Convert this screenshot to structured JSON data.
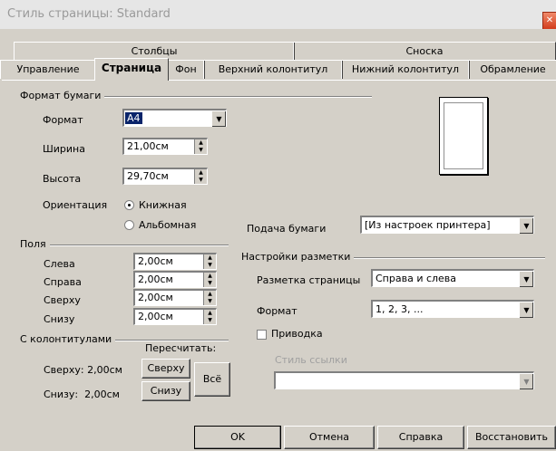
{
  "window": {
    "title": "Стиль страницы: Standard",
    "close": "✕"
  },
  "tabs": {
    "row1": [
      "Столбцы",
      "Сноска"
    ],
    "row2": [
      "Управление",
      "Страница",
      "Фон",
      "Верхний колонтитул",
      "Нижний колонтитул",
      "Обрамление"
    ],
    "active": "Страница"
  },
  "paper_format": {
    "section_title": "Формат бумаги",
    "format_label": "Формат",
    "format_value": "A4",
    "width_label": "Ширина",
    "width_value": "21,00см",
    "height_label": "Высота",
    "height_value": "29,70см",
    "orientation_label": "Ориентация",
    "portrait": "Книжная",
    "landscape": "Альбомная",
    "orientation_selected": "portrait",
    "paper_source_label": "Подача бумаги",
    "paper_source_value": "[Из настроек принтера]"
  },
  "margins": {
    "section_title": "Поля",
    "left_label": "Слева",
    "left_value": "2,00см",
    "right_label": "Справа",
    "right_value": "2,00см",
    "top_label": "Сверху",
    "top_value": "2,00см",
    "bottom_label": "Снизу",
    "bottom_value": "2,00см"
  },
  "with_headers": {
    "section_title": "С колонтитулами",
    "recalc_label": "Пересчитать:",
    "top_text": "Сверху: 2,00см",
    "bottom_text": "Снизу:  2,00см",
    "top_button": "Сверху",
    "bottom_button": "Снизу",
    "all_button": "Всё"
  },
  "layout": {
    "section_title": "Настройки разметки",
    "page_layout_label": "Разметка страницы",
    "page_layout_value": "Справа и слева",
    "format_label": "Формат",
    "format_value": "1, 2, 3, ...",
    "register_label": "Приводка",
    "register_checked": false,
    "ref_style_label": "Стиль ссылки",
    "ref_style_value": ""
  },
  "buttons": {
    "ok": "OK",
    "cancel": "Отмена",
    "help": "Справка",
    "reset": "Восстановить"
  },
  "icons": {
    "dropdown": "chevron-down-icon",
    "spin_up": "spin-up-icon",
    "spin_down": "spin-down-icon",
    "close": "close-icon"
  }
}
